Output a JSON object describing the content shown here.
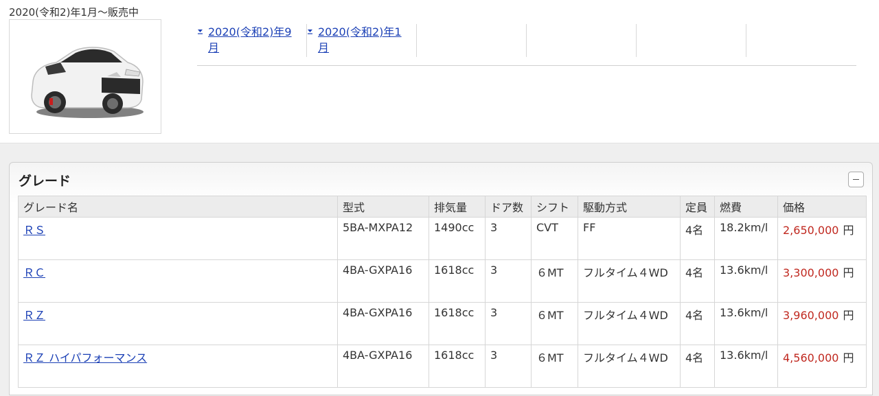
{
  "header": {
    "sale_period": "2020(令和2)年1月〜販売中"
  },
  "car_image": {
    "alt_name": "car-photo"
  },
  "periods": [
    {
      "label": "2020(令和2)年9月"
    },
    {
      "label": "2020(令和2)年1月"
    }
  ],
  "panel": {
    "title": "グレード",
    "collapse_icon": "minus-icon"
  },
  "table": {
    "headers": [
      "グレード名",
      "型式",
      "排気量",
      "ドア数",
      "シフト",
      "駆動方式",
      "定員",
      "燃費",
      "価格"
    ],
    "rows": [
      {
        "grade": "ＲＳ",
        "model": "5BA-MXPA12",
        "displacement": "1490cc",
        "doors": "3",
        "shift": "CVT",
        "drive": "FF",
        "capacity": "4名",
        "fuel": "18.2km/l",
        "price": "2,650,000",
        "unit": "円"
      },
      {
        "grade": "ＲＣ",
        "model": "4BA-GXPA16",
        "displacement": "1618cc",
        "doors": "3",
        "shift": "６MT",
        "drive": "フルタイム４WD",
        "capacity": "4名",
        "fuel": "13.6km/l",
        "price": "3,300,000",
        "unit": "円"
      },
      {
        "grade": "ＲＺ",
        "model": "4BA-GXPA16",
        "displacement": "1618cc",
        "doors": "3",
        "shift": "６MT",
        "drive": "フルタイム４WD",
        "capacity": "4名",
        "fuel": "13.6km/l",
        "price": "3,960,000",
        "unit": "円"
      },
      {
        "grade": "ＲＺ ハイパフォーマンス",
        "model": "4BA-GXPA16",
        "displacement": "1618cc",
        "doors": "3",
        "shift": "６MT",
        "drive": "フルタイム４WD",
        "capacity": "4名",
        "fuel": "13.6km/l",
        "price": "4,560,000",
        "unit": "円"
      }
    ]
  },
  "colors": {
    "link": "#1a3fb5",
    "price": "#c0281f",
    "header_bg": "#ececec"
  }
}
